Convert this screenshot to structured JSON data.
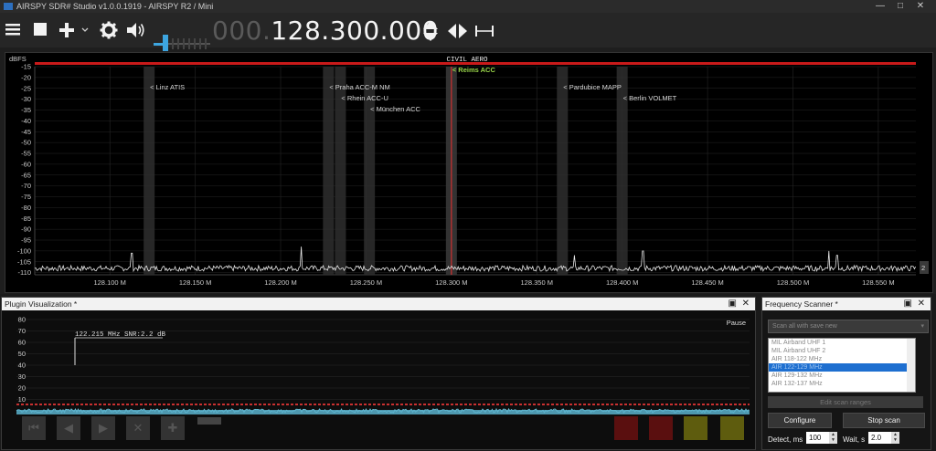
{
  "window": {
    "title": "AIRSPY SDR# Studio v1.0.0.1919 - AIRSPY R2 / Mini",
    "min": "—",
    "max": "□",
    "close": "✕"
  },
  "toolbar": {
    "menu_icon": "menu-icon",
    "stop_icon": "stop-icon",
    "add_icon": "add-icon",
    "settings_icon": "gear-icon",
    "volume_icon": "speaker-icon",
    "volume_level_percent": 20,
    "frequency_dim": "000.",
    "frequency_lit": "128.300.000",
    "icons_right": [
      "updown-arrows-icon",
      "leftright-arrows-icon",
      "span-icon"
    ]
  },
  "spectrum": {
    "ylabel": "dBFS",
    "band_label": "CIVIL AERO",
    "yticks": [
      "-15",
      "-20",
      "-25",
      "-30",
      "-35",
      "-40",
      "-45",
      "-50",
      "-55",
      "-60",
      "-65",
      "-70",
      "-75",
      "-80",
      "-85",
      "-90",
      "-95",
      "-100",
      "-105",
      "-110"
    ],
    "xticks": [
      "128.100 M",
      "128.150 M",
      "128.200 M",
      "128.250 M",
      "128.300 M",
      "128.350 M",
      "128.400 M",
      "128.450 M",
      "128.500 M",
      "128.550 M"
    ],
    "scroll_value": "2",
    "stations": [
      {
        "label": "< Linz ATIS",
        "freq": 128.123,
        "row": 0,
        "active": false
      },
      {
        "label": "< Praha ACC-M NM",
        "freq": 128.228,
        "row": 0,
        "active": false
      },
      {
        "label": "< Rhein ACC-U",
        "freq": 128.235,
        "row": 1,
        "active": false
      },
      {
        "label": "< München ACC",
        "freq": 128.252,
        "row": 2,
        "active": false
      },
      {
        "label": "< Reims ACC",
        "freq": 128.3,
        "row": -1,
        "active": true
      },
      {
        "label": "< Pardubice MAPP",
        "freq": 128.365,
        "row": 0,
        "active": false
      },
      {
        "label": "< Berlin VOLMET",
        "freq": 128.4,
        "row": 1,
        "active": false
      }
    ],
    "peaks": [
      {
        "freq": 128.113,
        "db": -101
      },
      {
        "freq": 128.212,
        "db": -98
      },
      {
        "freq": 128.372,
        "db": -102
      },
      {
        "freq": 128.412,
        "db": -100
      },
      {
        "freq": 128.521,
        "db": -100
      },
      {
        "freq": 128.526,
        "db": -102
      }
    ]
  },
  "plugin": {
    "title": "Plugin Visualization *",
    "pause": "Pause",
    "yticks": [
      "80",
      "70",
      "60",
      "50",
      "40",
      "30",
      "20",
      "10"
    ],
    "marker_label": "122.215 MHz SNR:2.2 dB",
    "max_icon": "maximize-icon",
    "close_icon": "close-icon"
  },
  "scanner": {
    "title": "Frequency Scanner *",
    "mode": "Scan all with save new",
    "ranges": [
      "MIL Airband UHF 1",
      "MIL Airband UHF 2",
      "AIR 118-122 MHz",
      "AIR 122-129 MHz",
      "AIR 129-132 MHz",
      "AIR 132-137 MHz"
    ],
    "selected_index": 3,
    "edit_label": "Edit scan ranges",
    "configure_label": "Configure",
    "stop_label": "Stop scan",
    "detect_label": "Detect, ms",
    "detect_value": "100",
    "wait_label": "Wait, s",
    "wait_value": "2.0"
  },
  "colors": {
    "accent": "#3da5e0",
    "marker": "#d03030",
    "active_station": "#9bd84a",
    "trace": "#e8e8e8"
  }
}
